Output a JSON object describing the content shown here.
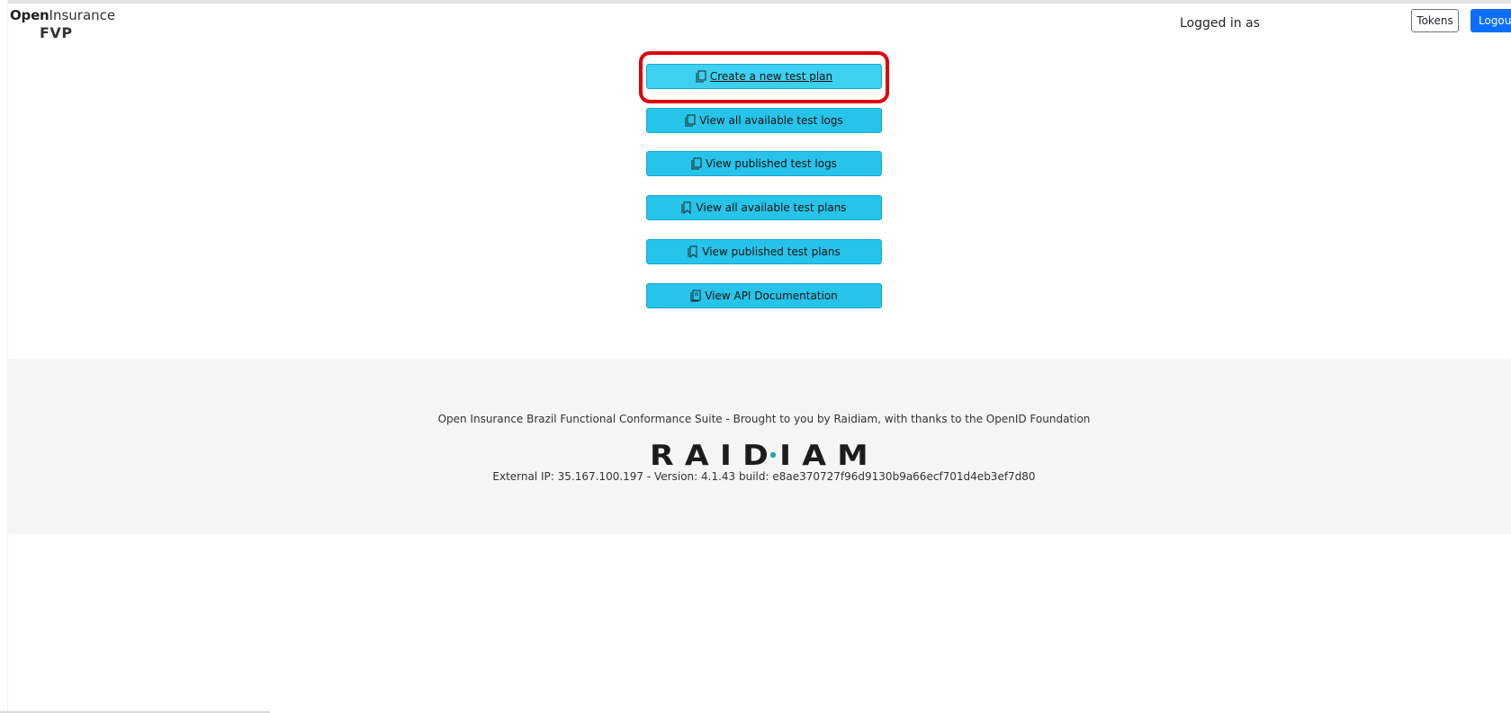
{
  "header": {
    "logo_open": "Open",
    "logo_insurance": "Insurance",
    "logo_sub": "FVP",
    "logged_in_label": "Logged in as",
    "tokens_label": "Tokens",
    "logout_label": "Logout"
  },
  "menu": {
    "items": [
      {
        "label": " Create a new test plan",
        "icon": "file-copy-icon"
      },
      {
        "label": "View all available test logs",
        "icon": "file-copy-icon"
      },
      {
        "label": "View published test logs",
        "icon": "file-copy-icon"
      },
      {
        "label": "View all available test plans",
        "icon": "bookmark-icon"
      },
      {
        "label": "View published test plans",
        "icon": "bookmark-icon"
      },
      {
        "label": "View API Documentation",
        "icon": "book-icon"
      }
    ]
  },
  "footer": {
    "credit": "Open Insurance Brazil Functional Conformance Suite - Brought to you by Raidiam, with thanks to the OpenID Foundation",
    "logo_text": "RAIDIAM",
    "build": "External IP: 35.167.100.197 - Version: 4.1.43 build: e8ae370727f96d9130b9a66ecf701d4eb3ef7d80"
  },
  "colors": {
    "button": "#27c4ea",
    "highlight": "#e0000a",
    "logout": "#0d6efd",
    "footer_bg": "#f5f5f5",
    "raidiam_accent": "#2aa7a7"
  }
}
